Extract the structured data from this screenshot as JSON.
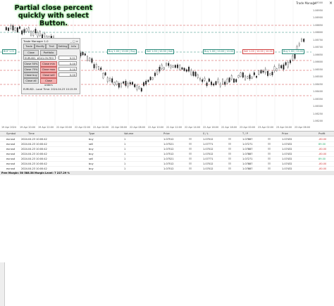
{
  "window": {
    "title": "Trade Manager"
  },
  "headline": "Partial close percent quickly with select Button.",
  "panel": {
    "title": "Trade Manager 1.0",
    "controls": "_ □ ×",
    "tabs": [
      "Trade",
      "Modify",
      "Trail",
      "Setting",
      "Info"
    ],
    "close_label": "Close",
    "portfolio_label": "Portfolio",
    "symbol": "EURUSD, #541.0%TEO",
    "lot": "0.01",
    "rows": [
      {
        "btn_a": "Close 50%",
        "btn_b": "Close min",
        "value": "0.00"
      },
      {
        "btn_a": "Close 75%",
        "btn_b": "Close max",
        "value": "0.00"
      },
      {
        "btn_a": "Close buy",
        "btn_b": "Close sell",
        "value": "0.00"
      },
      {
        "btn_a": "Close all",
        "btn_b": "Close orders",
        "value": ""
      }
    ],
    "status": "EURUSD - Local Time: 2024.04.23 10:15:59"
  },
  "chart": {
    "side_tag": "BUY 1.01",
    "price_tags": [
      {
        "text": "Buy 1.00 | 10.00 | Buy",
        "color": "g"
      },
      {
        "text": "Sell 1.00 | 10.00 | Sell",
        "color": "g"
      },
      {
        "text": "Buy 1.00 | 10.00 | 10.00",
        "color": "g"
      },
      {
        "text": "Sell 1.00 | 10.00 | 10.00",
        "color": "r"
      },
      {
        "text": "Buy 1.00 | 10.00",
        "color": "g"
      }
    ],
    "x_labels": [
      "19 Apr 2024",
      "19 Apr 20:00",
      "19 Apr 22:00",
      "22 Apr 00:00",
      "22 Apr 02:00",
      "22 Apr 04:00",
      "22 Apr 06:00",
      "22 Apr 08:00",
      "22 Apr 10:00",
      "22 Apr 12:00",
      "22 Apr 14:00",
      "22 Apr 16:00",
      "22 Apr 18:00",
      "23 Apr 00:00",
      "23 Apr 02:00",
      "23 Apr 04:00",
      "23 Apr 06:00"
    ],
    "y_labels": [
      "1.07000",
      "1.06950",
      "1.06900",
      "1.06850",
      "1.06800",
      "1.06750",
      "1.06700",
      "1.06650",
      "1.06600",
      "1.06550",
      "1.06500",
      "1.06450",
      "1.06400",
      "1.06350",
      "1.06300",
      "1.06250",
      "1.06200"
    ],
    "colors": {
      "bull": "#222222",
      "bear": "#222222",
      "line_green": "#2a8a7a",
      "line_red": "#d04040",
      "panel_bg": "#f0f0f0"
    }
  },
  "toolbox": {
    "headers": [
      "Symbol",
      "Time",
      "Type",
      "Volume",
      "Price",
      "S / L",
      "T / P",
      "Price",
      "Profit"
    ],
    "rows": [
      {
        "symbol": "eurusd",
        "time": "2024.04.23 10:00:42",
        "type": "buy",
        "volume": "1",
        "price": "1.07512",
        "sl": "1.07012",
        "tp": "1.07887",
        "cur": "1.07432",
        "profit": "-80.00"
      },
      {
        "symbol": "eurusd",
        "time": "2024.04.23 10:00:42",
        "type": "sell",
        "volume": "1",
        "price": "1.07521",
        "sl": "1.07771",
        "tp": "1.07271",
        "cur": "1.07432",
        "profit": "89.00"
      },
      {
        "symbol": "eurusd",
        "time": "2024.04.23 10:00:42",
        "type": "buy",
        "volume": "1",
        "price": "1.07512",
        "sl": "1.07012",
        "tp": "1.07887",
        "cur": "1.07432",
        "profit": "-80.00"
      },
      {
        "symbol": "eurusd",
        "time": "2024.04.23 10:00:42",
        "type": "buy",
        "volume": "1",
        "price": "1.07512",
        "sl": "1.07012",
        "tp": "1.07887",
        "cur": "1.07432",
        "profit": "-80.00"
      },
      {
        "symbol": "eurusd",
        "time": "2024.04.23 10:00:42",
        "type": "sell",
        "volume": "1",
        "price": "1.07521",
        "sl": "1.07771",
        "tp": "1.07271",
        "cur": "1.07432",
        "profit": "89.00"
      },
      {
        "symbol": "eurusd",
        "time": "2024.04.23 10:00:42",
        "type": "buy",
        "volume": "1",
        "price": "1.07512",
        "sl": "1.07012",
        "tp": "1.07887",
        "cur": "1.07432",
        "profit": "-80.00"
      },
      {
        "symbol": "eurusd",
        "time": "2024.04.23 10:00:42",
        "type": "buy",
        "volume": "1",
        "price": "1.07512",
        "sl": "1.07012",
        "tp": "1.07887",
        "cur": "1.07432",
        "profit": "-80.00"
      }
    ],
    "summary": "Free Margin: 50 588.58  Margin Level: 7 227.29 %"
  }
}
